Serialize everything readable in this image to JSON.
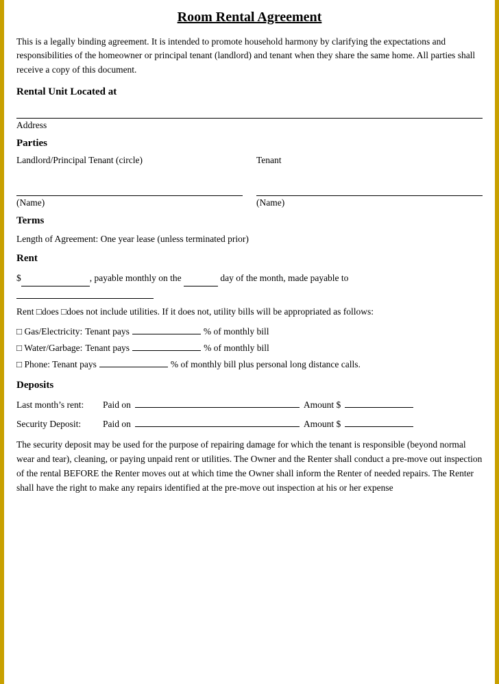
{
  "document": {
    "title": "Room Rental Agreement",
    "intro": "This is a legally binding agreement. It is intended to promote household harmony by clarifying the expectations and responsibilities of the homeowner or principal tenant (landlord) and tenant when they share the same home. All parties shall receive a copy of this document.",
    "sections": {
      "rental_unit": {
        "heading": "Rental Unit Located at",
        "field_label": "Address"
      },
      "parties": {
        "heading": "Parties",
        "landlord_header": "Landlord/Principal Tenant (circle)",
        "tenant_header": "Tenant",
        "name_label": "(Name)"
      },
      "terms": {
        "heading": "Terms",
        "length_text": "Length of Agreement: One year lease (unless terminated prior)"
      },
      "rent": {
        "heading": "Rent",
        "rent_line": ", payable monthly on the",
        "rent_line2": "day of the month, made payable to",
        "dollar_sign": "$",
        "utilities_text": "Rent □does □does not include utilities. If it does not, utility bills will be appropriated as follows:",
        "utilities": [
          {
            "label": "□ Gas/Electricity:",
            "text": "Tenant pays",
            "blank": "",
            "suffix": "% of monthly bill"
          },
          {
            "label": "□ Water/Garbage:",
            "text": "Tenant pays",
            "blank": "",
            "suffix": "% of monthly bill"
          },
          {
            "label": "□ Phone: Tenant pays",
            "blank": "",
            "suffix": "% of monthly bill plus personal long distance calls."
          }
        ]
      },
      "deposits": {
        "heading": "Deposits",
        "items": [
          {
            "label": "Last month’s rent:",
            "paid_on": "Paid on",
            "amount_label": "Amount $"
          },
          {
            "label": "Security Deposit:",
            "paid_on": "Paid on",
            "amount_label": "Amount $"
          }
        ],
        "security_text": "The security deposit may be used for the purpose of repairing damage for which the tenant is responsible (beyond normal wear and tear), cleaning, or paying unpaid rent or utilities. The Owner and the Renter shall conduct a pre-move out inspection of the rental BEFORE the Renter moves out at which time the Owner shall inform the Renter of needed repairs. The Renter shall have the right to make any repairs identified at the pre-move out inspection at his or her expense"
      }
    }
  }
}
